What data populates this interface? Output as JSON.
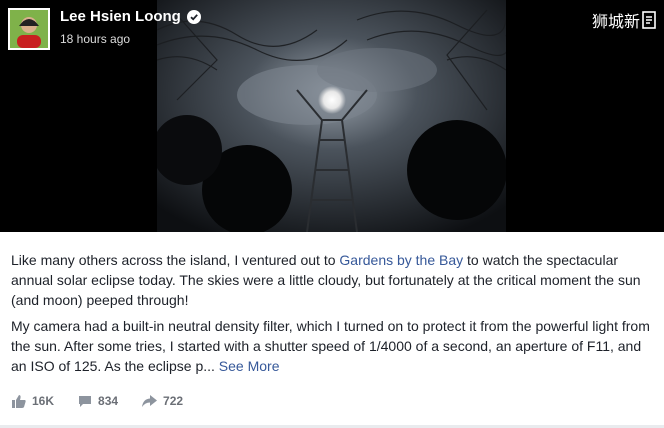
{
  "post": {
    "author_name": "Lee Hsien Loong",
    "timestamp": "18 hours ago",
    "verified_icon": "verified-badge-icon",
    "watermark": "狮城新",
    "paragraph1_before": "Like many others across the island, I ventured out to ",
    "paragraph1_link": "Gardens by the Bay",
    "paragraph1_after": " to watch the spectacular annual solar eclipse today. The skies were a little cloudy, but fortunately at the critical moment the sun (and moon) peeped through!",
    "paragraph2": "My camera had a built-in neutral density filter, which I turned on to protect it from the powerful light from the sun. After some tries, I started with a shutter speed of 1/4000 of a second, an aperture of F11, and an ISO of 125. As the eclipse p...",
    "see_more": "See More",
    "likes": "16K",
    "comments": "834",
    "shares": "722"
  },
  "colors": {
    "link": "#365899",
    "text": "#1d2129",
    "muted": "#6b6f76",
    "media_bg": "#000000"
  }
}
